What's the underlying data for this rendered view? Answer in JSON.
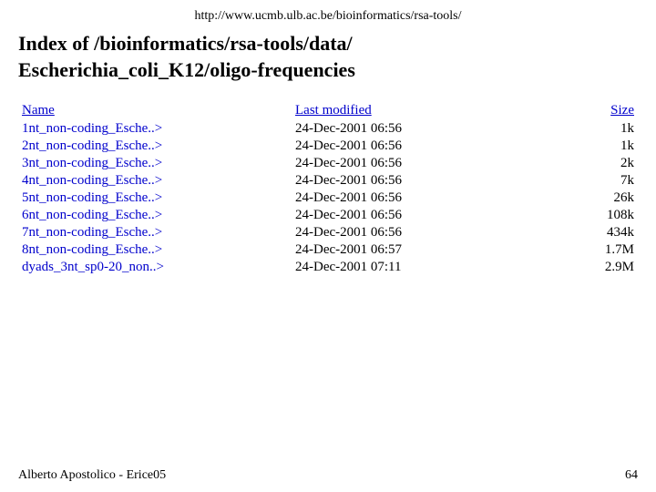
{
  "url": "http://www.ucmb.ulb.ac.be/bioinformatics/rsa-tools/",
  "page_title_line1": "Index of /bioinformatics/rsa-tools/data/",
  "page_title_line2": "Escherichia_coli_K12/oligo-frequencies",
  "table": {
    "headers": {
      "name": "Name",
      "last_modified": "Last modified",
      "size": "Size"
    },
    "rows": [
      {
        "name": "1nt_non-coding_Esche..>",
        "modified": "24-Dec-2001 06:56",
        "size": "1k"
      },
      {
        "name": "2nt_non-coding_Esche..>",
        "modified": "24-Dec-2001 06:56",
        "size": "1k"
      },
      {
        "name": "3nt_non-coding_Esche..>",
        "modified": "24-Dec-2001 06:56",
        "size": "2k"
      },
      {
        "name": "4nt_non-coding_Esche..>",
        "modified": "24-Dec-2001 06:56",
        "size": "7k"
      },
      {
        "name": "5nt_non-coding_Esche..>",
        "modified": "24-Dec-2001 06:56",
        "size": "26k"
      },
      {
        "name": "6nt_non-coding_Esche..>",
        "modified": "24-Dec-2001 06:56",
        "size": "108k"
      },
      {
        "name": "7nt_non-coding_Esche..>",
        "modified": "24-Dec-2001 06:56",
        "size": "434k"
      },
      {
        "name": "8nt_non-coding_Esche..>",
        "modified": "24-Dec-2001 06:57",
        "size": "1.7M"
      },
      {
        "name": "dyads_3nt_sp0-20_non..>",
        "modified": "24-Dec-2001 07:11",
        "size": "2.9M"
      }
    ]
  },
  "footer": {
    "credit": "Alberto Apostolico - Erice05",
    "page_number": "64"
  }
}
